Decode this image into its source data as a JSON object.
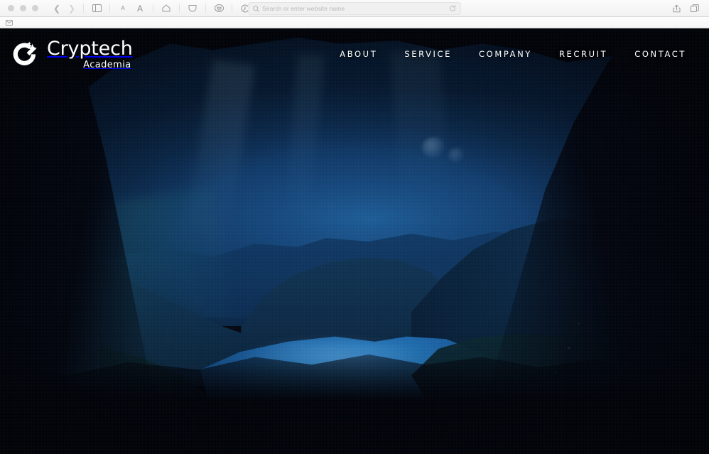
{
  "browser": {
    "window_controls": [
      "close",
      "minimize",
      "zoom"
    ],
    "back_label": "Back",
    "forward_label": "Forward",
    "sidebar_label": "Show Sidebar",
    "text_size_small_label": "A",
    "text_size_large_label": "A",
    "home_label": "Home",
    "privacy_label": "Privacy Report",
    "reader_label": "Reader",
    "extension_label": "Extension",
    "share_label": "Share",
    "tabs_label": "Show Tab Overview",
    "address": {
      "value": "",
      "placeholder": "Search or enter website name",
      "search_icon": "search-icon",
      "reload_icon": "reload-icon"
    },
    "bookmarks": [
      {
        "label": "",
        "icon": "mail-icon"
      }
    ]
  },
  "site": {
    "brand": {
      "name": "Cryptech",
      "sub": "Academia",
      "logo_icon": "cryptech-c-star-logo"
    },
    "nav": [
      {
        "label": "ABOUT"
      },
      {
        "label": "SERVICE"
      },
      {
        "label": "COMPANY"
      },
      {
        "label": "RECRUIT"
      },
      {
        "label": "CONTACT"
      }
    ],
    "hero": {
      "alt": "Night view of a mountain valley and lake seen from inside a cave mouth",
      "colors": {
        "sky": "#16497e",
        "lake": "#2173b6",
        "cave": "#01030a",
        "text": "#ffffff"
      }
    }
  }
}
